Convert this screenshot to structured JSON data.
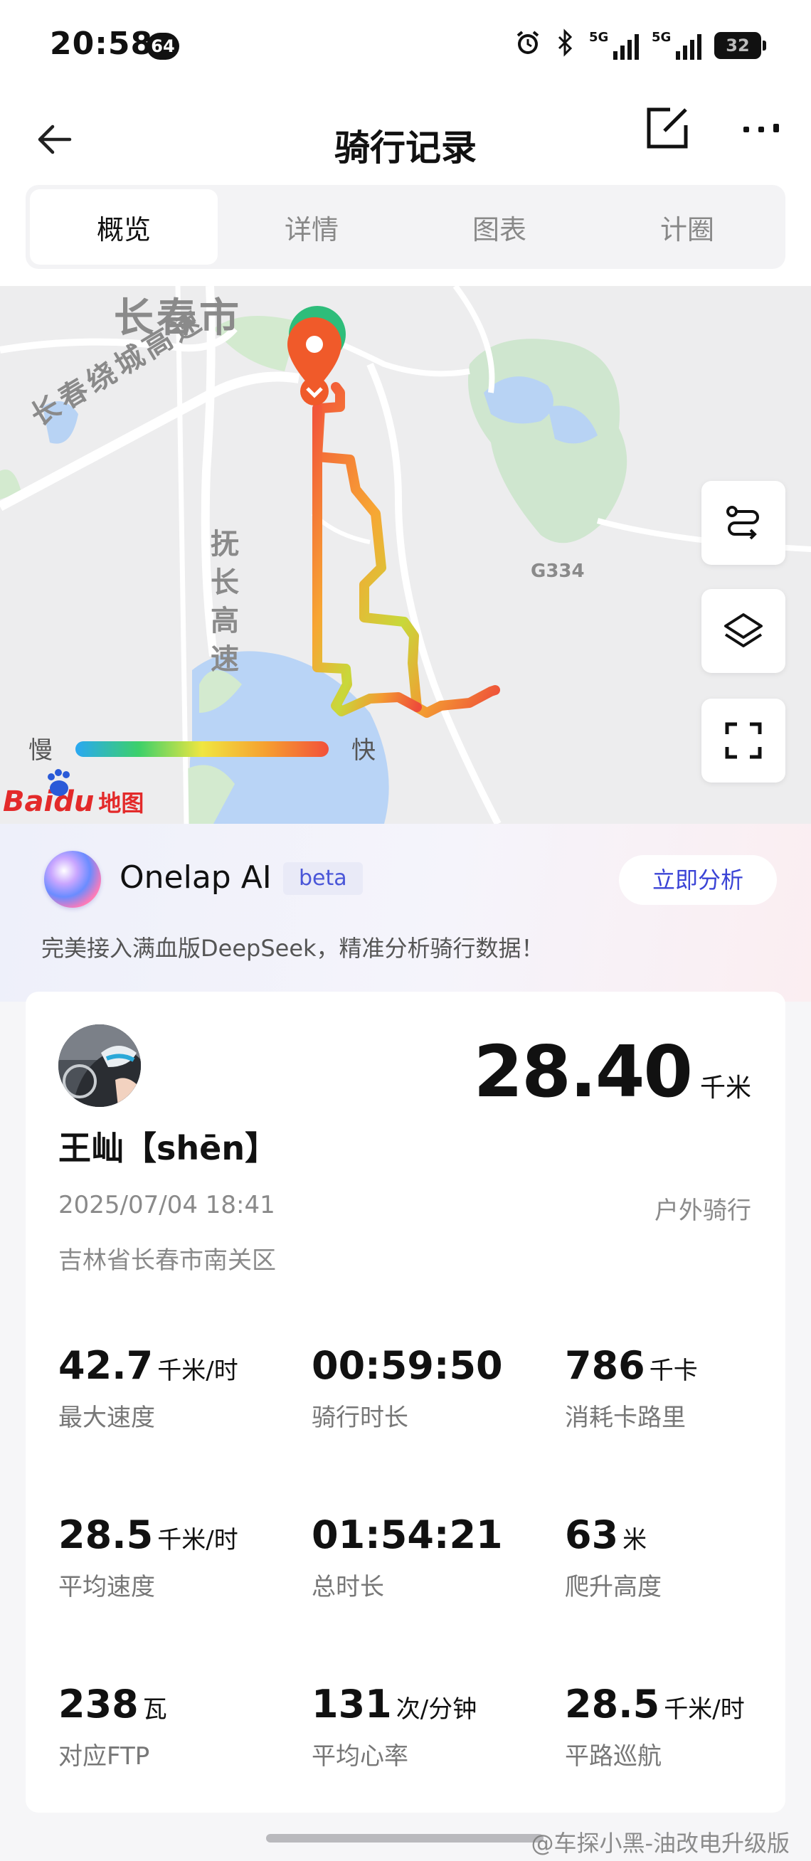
{
  "status_bar": {
    "time": "20:58",
    "badge": "64",
    "signal_1": "5G",
    "signal_2": "5G",
    "battery": "32"
  },
  "header": {
    "title": "骑行记录"
  },
  "tabs": [
    {
      "label": "概览",
      "active": true
    },
    {
      "label": "详情",
      "active": false
    },
    {
      "label": "图表",
      "active": false
    },
    {
      "label": "计圈",
      "active": false
    }
  ],
  "map": {
    "labels": {
      "city": "长春市",
      "ring_road": "长春绕城高速",
      "highway": "抚长高速",
      "g334": "G334"
    },
    "speed_legend": {
      "slow": "慢",
      "fast": "快"
    },
    "provider_logo": {
      "brand": "Baidu",
      "suffix": "地图"
    }
  },
  "ai": {
    "title": "Onelap AI",
    "badge": "beta",
    "analyze_button": "立即分析",
    "description": "完美接入满血版DeepSeek，精准分析骑行数据！"
  },
  "ride": {
    "distance": "28.40",
    "distance_unit": "千米",
    "rider_name": "王屾【shēn】",
    "datetime": "2025/07/04 18:41",
    "type": "户外骑行",
    "location": "吉林省长春市南关区",
    "stats": [
      {
        "value": "42.7",
        "unit": "千米/时",
        "label": "最大速度"
      },
      {
        "value": "00:59:50",
        "unit": "",
        "label": "骑行时长"
      },
      {
        "value": "786",
        "unit": "千卡",
        "label": "消耗卡路里"
      },
      {
        "value": "28.5",
        "unit": "千米/时",
        "label": "平均速度"
      },
      {
        "value": "01:54:21",
        "unit": "",
        "label": "总时长"
      },
      {
        "value": "63",
        "unit": "米",
        "label": "爬升高度"
      },
      {
        "value": "238",
        "unit": "瓦",
        "label": "对应FTP"
      },
      {
        "value": "131",
        "unit": "次/分钟",
        "label": "平均心率"
      },
      {
        "value": "28.5",
        "unit": "千米/时",
        "label": "平路巡航"
      }
    ]
  },
  "watermark": "@车探小黑-油改电升级版",
  "colors": {
    "accent_blue": "#3b44d6",
    "route_start": "#2ebd7a",
    "route_end": "#f05a2a",
    "water": "#b9d4f6",
    "park": "#cfe8cf"
  }
}
